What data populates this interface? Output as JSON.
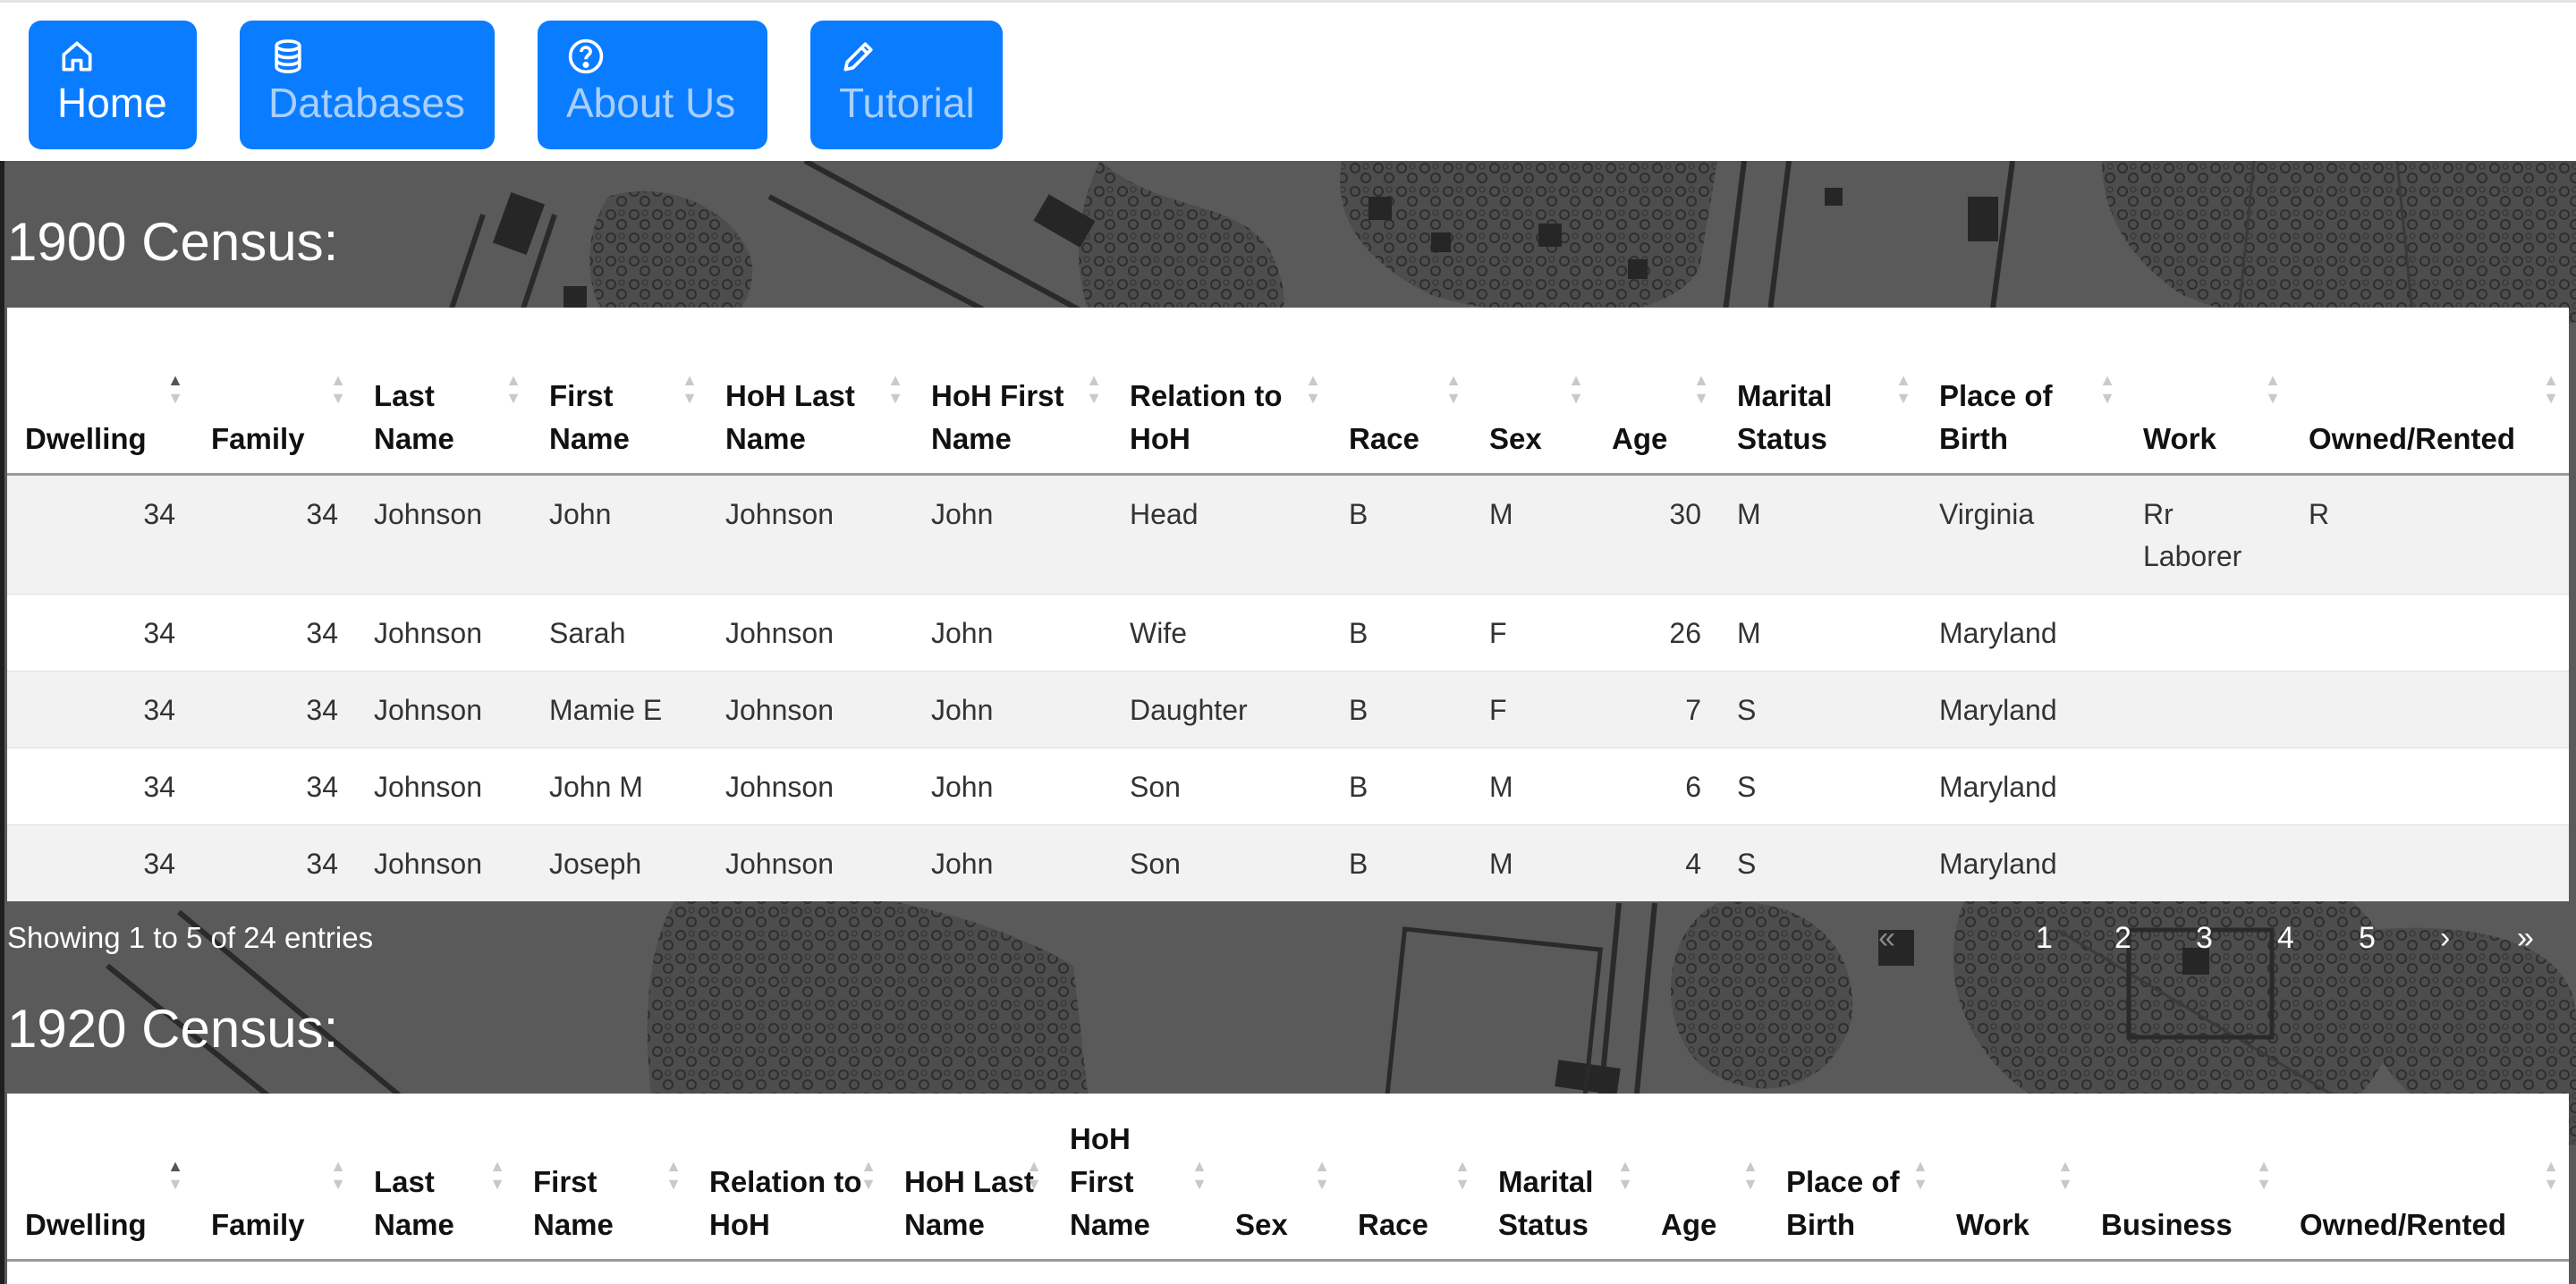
{
  "nav": {
    "items": [
      {
        "label": "Home",
        "icon": "home-icon"
      },
      {
        "label": "Databases",
        "icon": "database-icon"
      },
      {
        "label": "About Us",
        "icon": "question-circle-icon"
      },
      {
        "label": "Tutorial",
        "icon": "pencil-icon"
      }
    ]
  },
  "colors": {
    "nav_button": "#0a7cff",
    "nav_dim_text": "#a9cff9",
    "map_bg": "#5a5a5a"
  },
  "census1900": {
    "title": "1900 Census:",
    "columns": [
      "Dwelling",
      "Family",
      "Last Name",
      "First Name",
      "HoH Last Name",
      "HoH First Name",
      "Relation to HoH",
      "Race",
      "Sex",
      "Age",
      "Marital Status",
      "Place of Birth",
      "Work",
      "Owned/Rented"
    ],
    "rows": [
      [
        "34",
        "34",
        "Johnson",
        "John",
        "Johnson",
        "John",
        "Head",
        "B",
        "M",
        "30",
        "M",
        "Virginia",
        "Rr Laborer",
        "R"
      ],
      [
        "34",
        "34",
        "Johnson",
        "Sarah",
        "Johnson",
        "John",
        "Wife",
        "B",
        "F",
        "26",
        "M",
        "Maryland",
        "",
        ""
      ],
      [
        "34",
        "34",
        "Johnson",
        "Mamie E",
        "Johnson",
        "John",
        "Daughter",
        "B",
        "F",
        "7",
        "S",
        "Maryland",
        "",
        ""
      ],
      [
        "34",
        "34",
        "Johnson",
        "John M",
        "Johnson",
        "John",
        "Son",
        "B",
        "M",
        "6",
        "S",
        "Maryland",
        "",
        ""
      ],
      [
        "34",
        "34",
        "Johnson",
        "Joseph",
        "Johnson",
        "John",
        "Son",
        "B",
        "M",
        "4",
        "S",
        "Maryland",
        "",
        ""
      ]
    ],
    "info": "Showing 1 to 5 of 24 entries",
    "pagination": {
      "first": "«",
      "pages": [
        "1",
        "2",
        "3",
        "4",
        "5"
      ],
      "next": "›",
      "last": "»"
    }
  },
  "census1920": {
    "title": "1920 Census:",
    "columns": [
      "Dwelling",
      "Family",
      "Last Name",
      "First Name",
      "Relation to HoH",
      "HoH Last Name",
      "HoH First Name",
      "Sex",
      "Race",
      "Marital Status",
      "Age",
      "Place of Birth",
      "Work",
      "Business",
      "Owned/Rented"
    ]
  }
}
